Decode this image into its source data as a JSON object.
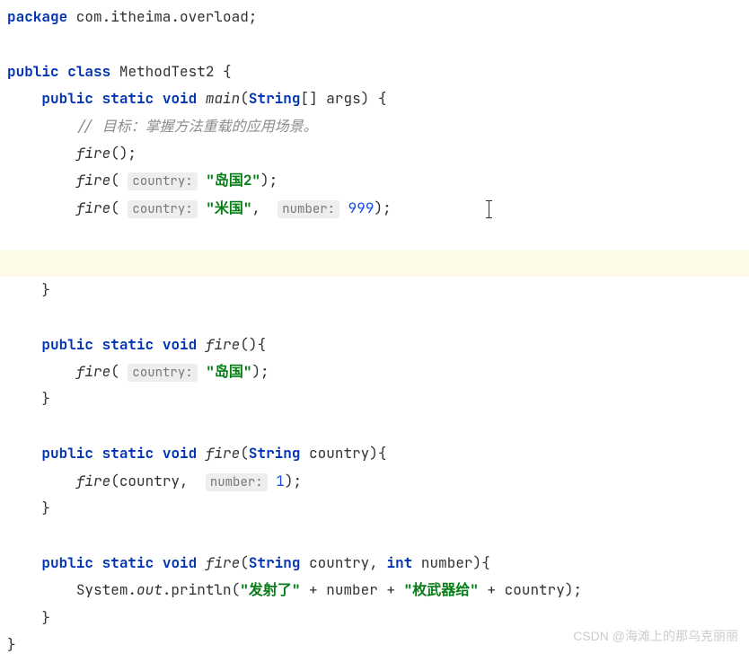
{
  "code": {
    "line1_kw_package": "package",
    "line1_pkg": " com.itheima.overload;",
    "line3_kw_public": "public",
    "line3_kw_class": "class",
    "line3_cls": "MethodTest2",
    "line4_kw_public": "public",
    "line4_kw_static": "static",
    "line4_kw_void": "void",
    "line4_method": "main",
    "line4_type": "String",
    "line4_args": "[] args) {",
    "line5_comment": "// 目标：掌握方法重载的应用场景。",
    "line6_fire": "fire",
    "line6_paren": "();",
    "line7_fire": "fire",
    "line7_hint": "country:",
    "line7_str": "\"岛国2\"",
    "line8_fire": "fire",
    "line8_hint1": "country:",
    "line8_str": "\"米国\"",
    "line8_hint2": "number:",
    "line8_num": "999",
    "line12_kw_public": "public",
    "line12_kw_static": "static",
    "line12_kw_void": "void",
    "line12_fire": "fire",
    "line13_fire": "fire",
    "line13_hint": "country:",
    "line13_str": "\"岛国\"",
    "line16_kw_public": "public",
    "line16_kw_static": "static",
    "line16_kw_void": "void",
    "line16_fire": "fire",
    "line16_type": "String",
    "line16_param": " country){",
    "line17_fire": "fire",
    "line17_country": "(country, ",
    "line17_hint": "number:",
    "line17_num": "1",
    "line20_kw_public": "public",
    "line20_kw_static": "static",
    "line20_kw_void": "void",
    "line20_fire": "fire",
    "line20_type1": "String",
    "line20_country": " country, ",
    "line20_kw_int": "int",
    "line20_number": " number){",
    "line21_sys": "System.",
    "line21_out": "out",
    "line21_print": ".println(",
    "line21_str1": "\"发射了\"",
    "line21_plus1": " + number + ",
    "line21_str2": "\"枚武器给\"",
    "line21_plus2": " + country);"
  },
  "watermark": "CSDN @海滩上的那乌克丽丽"
}
